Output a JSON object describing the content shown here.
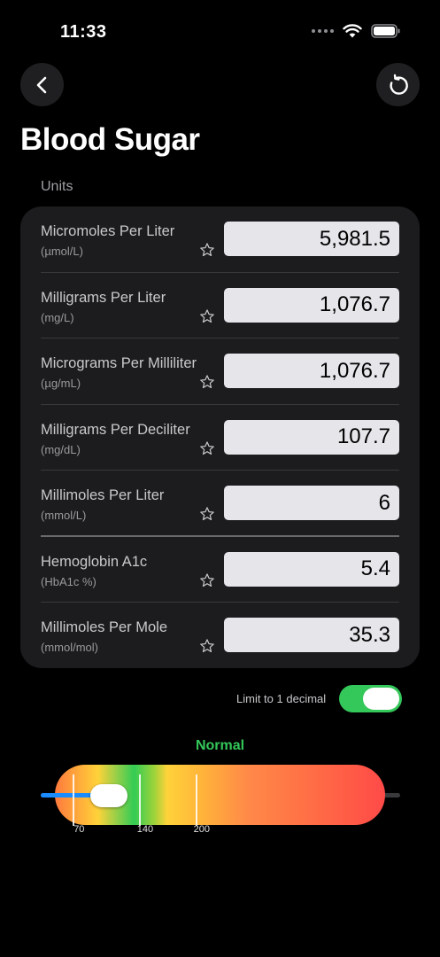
{
  "status_bar": {
    "time": "11:33"
  },
  "title": "Blood Sugar",
  "units_label": "Units",
  "units": [
    {
      "name": "Micromoles Per Liter",
      "abbr": "(µmol/L)",
      "value": "5,981.5"
    },
    {
      "name": "Milligrams Per Liter",
      "abbr": "(mg/L)",
      "value": "1,076.7"
    },
    {
      "name": "Micrograms Per Milliliter",
      "abbr": "(µg/mL)",
      "value": "1,076.7"
    },
    {
      "name": "Milligrams Per Deciliter",
      "abbr": "(mg/dL)",
      "value": "107.7"
    },
    {
      "name": "Millimoles Per Liter",
      "abbr": "(mmol/L)",
      "value": "6"
    },
    {
      "name": "Hemoglobin A1c",
      "abbr": "(HbA1c %)",
      "value": "5.4"
    },
    {
      "name": "Millimoles Per Mole",
      "abbr": "(mmol/mol)",
      "value": "35.3"
    }
  ],
  "limit_toggle": {
    "label": "Limit to 1 decimal",
    "on": true,
    "color": "#34c759"
  },
  "range": {
    "status": "Normal",
    "status_color": "#34c759",
    "value_mg_dl": 107.7,
    "scale_min": 50,
    "scale_max": 400,
    "ticks": [
      {
        "value": 70,
        "label": "70"
      },
      {
        "value": 140,
        "label": "140"
      },
      {
        "value": 200,
        "label": "200"
      }
    ]
  },
  "icons": {
    "back": "chevron-left-icon",
    "reset": "reset-icon",
    "favorite": "star-outline-icon"
  }
}
